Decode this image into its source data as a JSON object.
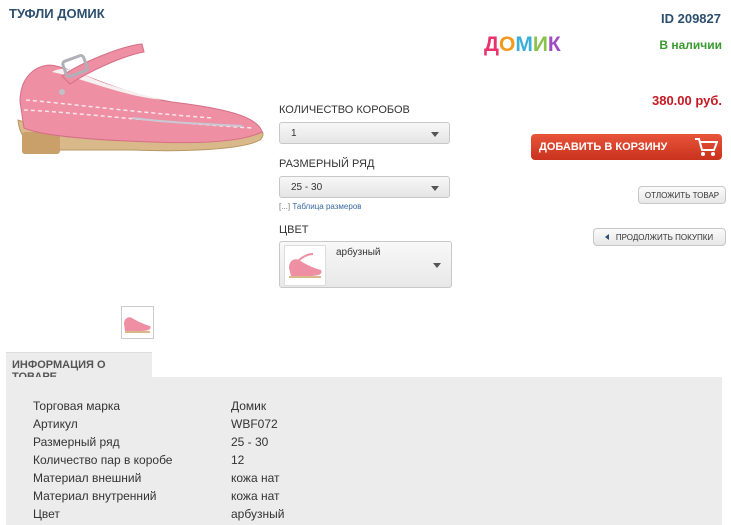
{
  "product": {
    "title": "ТУФЛИ ДОМИК",
    "id_label": "ID 209827",
    "brand_logo_text": "ДОМИК",
    "brand_logo_letters": [
      {
        "ch": "Д",
        "color": "#e8336b"
      },
      {
        "ch": "О",
        "color": "#f29a1c"
      },
      {
        "ch": "М",
        "color": "#3ab0d8"
      },
      {
        "ch": "И",
        "color": "#8bc34a"
      },
      {
        "ch": "К",
        "color": "#a14bc2"
      }
    ],
    "stock_status": "В наличии",
    "price": "380.00 руб."
  },
  "options": {
    "boxes_label": "КОЛИЧЕСТВО КОРОБОВ",
    "boxes_value": "1",
    "size_label": "РАЗМЕРНЫЙ РЯД",
    "size_value": "25 - 30",
    "size_table_bracket": "[...]",
    "size_table_link": "Таблица размеров",
    "color_label": "ЦВЕТ",
    "color_value": "арбузный"
  },
  "actions": {
    "add_to_cart": "ДОБАВИТЬ В КОРЗИНУ",
    "defer": "ОТЛОЖИТЬ ТОВАР",
    "continue_shopping": "ПРОДОЛЖИТЬ ПОКУПКИ"
  },
  "info": {
    "tab_label": "ИНФОРМАЦИЯ О ТОВАРЕ",
    "rows": [
      {
        "key": "Торговая марка",
        "value": "Домик"
      },
      {
        "key": "Артикул",
        "value": "WBF072"
      },
      {
        "key": "Размерный ряд",
        "value": "25 - 30"
      },
      {
        "key": "Количество пар в коробе",
        "value": "12"
      },
      {
        "key": "Материал внешний",
        "value": "кожа нат"
      },
      {
        "key": "Материал внутренний",
        "value": "кожа нат"
      },
      {
        "key": "Цвет",
        "value": "арбузный"
      }
    ]
  },
  "colors": {
    "heading": "#2d4f6e",
    "stock": "#3a9a30",
    "price": "#c41922",
    "cart_button": "#d93c25",
    "shoe_pink": "#ee8fa3"
  }
}
